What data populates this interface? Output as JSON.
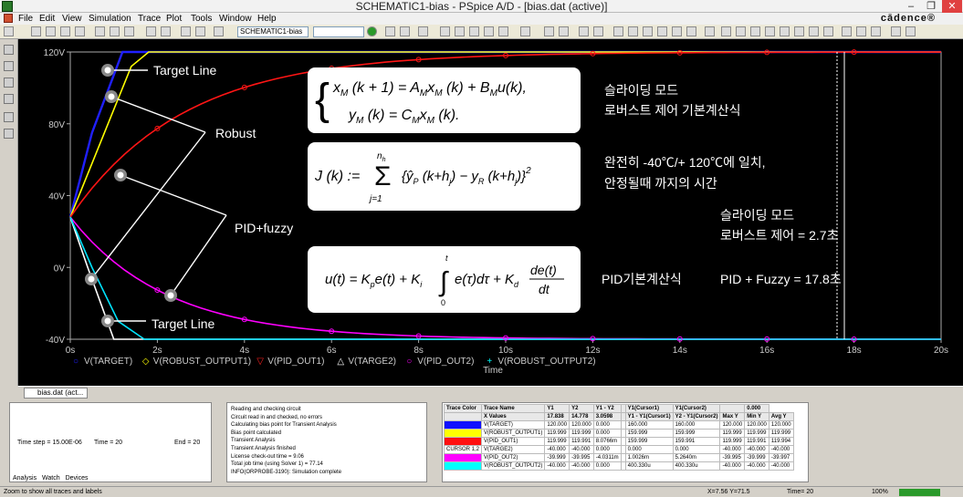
{
  "window": {
    "title": "SCHEMATIC1-bias - PSpice A/D - [bias.dat (active)]",
    "min": "–",
    "max": "❐",
    "close": "✕",
    "brand": "cādence®"
  },
  "menu": [
    "File",
    "Edit",
    "View",
    "Simulation",
    "Trace",
    "Plot",
    "Tools",
    "Window",
    "Help"
  ],
  "toolbar": {
    "profile_value": "SCHEMATIC1-bias",
    "search_value": ""
  },
  "plot": {
    "y_ticks": [
      "120V",
      "80V",
      "40V",
      "0V",
      "-40V"
    ],
    "x_ticks": [
      "0s",
      "2s",
      "4s",
      "6s",
      "8s",
      "10s",
      "12s",
      "14s",
      "16s",
      "18s",
      "20s"
    ],
    "x_label": "Time",
    "legend": [
      {
        "name": "V(TARGET)",
        "marker": "○",
        "color": "#2020ff"
      },
      {
        "name": "V(ROBUST_OUTPUT1)",
        "marker": "◇",
        "color": "#ffff00"
      },
      {
        "name": "V(PID_OUT1)",
        "marker": "▽",
        "color": "#ff2020"
      },
      {
        "name": "V(TARGE2)",
        "marker": "△",
        "color": "#ffffff"
      },
      {
        "name": "V(PID_OUT2)",
        "marker": "○",
        "color": "#ff00ff"
      },
      {
        "name": "V(ROBUST_OUTPUT2)",
        "marker": "+",
        "color": "#00ffff"
      }
    ],
    "annotations": {
      "target_top": "Target Line",
      "robust": "Robust",
      "pid_fuzzy": "PID+fuzzy",
      "target_bottom": "Target Line",
      "sliding1": "슬라이딩 모드",
      "robust_basic": "로버스트 제어 기본계산식",
      "fully_match": "완전히 -40℃/+ 120℃에 일치,",
      "time_stable": "안정될때 까지의 시간",
      "sliding2": "슬라이딩 모드",
      "robust_time": "로버스트 제어 = 2.7초",
      "pid_basic": "PID기본계산식",
      "pid_fuzzy_time": "PID + Fuzzy = 17.8초"
    }
  },
  "doc_tab": "bias.dat (act...",
  "sim_panel": {
    "time_step": "Time step = 15.00E-06",
    "time": "Time = 20",
    "end": "End = 20",
    "tabs": [
      "Analysis",
      "Watch",
      "Devices"
    ]
  },
  "log_lines": [
    "Reading and checking circuit",
    "Circuit read in and checked, no errors",
    "Calculating bias point for Transient Analysis",
    "Bias point calculated",
    "Transient Analysis",
    "Transient Analysis finished",
    "License check-out time         =        9.06",
    "Total job time (using Solver 1)   =       77.14",
    "INFO(ORPROBE-3190): Simulation complete"
  ],
  "cursor_table": {
    "header": [
      "Trace Color",
      "Trace Name",
      "Y1",
      "Y2",
      "Y1 - Y2",
      "",
      "Y1(Cursor1)",
      "Y1(Cursor2)",
      "",
      "0.000"
    ],
    "subheader": [
      "",
      "X Values",
      "17.838",
      "14.778",
      "3.0598",
      "",
      "Y1 - Y1(Cursor1)",
      "Y2 - Y1(Cursor2)",
      "Max Y",
      "Min Y",
      "Avg Y"
    ],
    "rows": [
      {
        "color": "#1010ff",
        "name": "V(TARGET)",
        "vals": [
          "120.000",
          "120.000",
          "0.000",
          "",
          "160.000",
          "160.000",
          "120.000",
          "120.000",
          "120.000"
        ]
      },
      {
        "color": "#ffff00",
        "name": "V(ROBUST_OUTPUT1)",
        "vals": [
          "119.999",
          "119.999",
          "0.000",
          "",
          "159.999",
          "159.999",
          "119.999",
          "119.999",
          "119.999"
        ]
      },
      {
        "color": "#ff1010",
        "name": "V(PID_OUT1)",
        "vals": [
          "119.999",
          "119.991",
          "8.0766m",
          "",
          "159.999",
          "159.991",
          "119.999",
          "119.991",
          "119.994"
        ]
      },
      {
        "color": "#ffffff",
        "name": "V(TARGE2)",
        "label": "CURSOR 1,2",
        "vals": [
          "-40.000",
          "-40.000",
          "0.000",
          "",
          "0.000",
          "0.000",
          "-40.000",
          "-40.000",
          "-40.000"
        ]
      },
      {
        "color": "#ff00ff",
        "name": "V(PID_OUT2)",
        "vals": [
          "-39.999",
          "-39.995",
          "-4.0311m",
          "",
          "1.0026m",
          "5.2640m",
          "-39.995",
          "-39.999",
          "-39.997"
        ]
      },
      {
        "color": "#00ffff",
        "name": "V(ROBUST_OUTPUT2)",
        "vals": [
          "-40.000",
          "-40.000",
          "0.000",
          "",
          "400.330u",
          "400.330u",
          "-40.000",
          "-40.000",
          "-40.000"
        ]
      }
    ]
  },
  "status": {
    "hint": "Zoom to show all traces and labels",
    "xy": "X=7.56  Y=71.5",
    "time": "Time= 20",
    "zoom": "100%"
  }
}
